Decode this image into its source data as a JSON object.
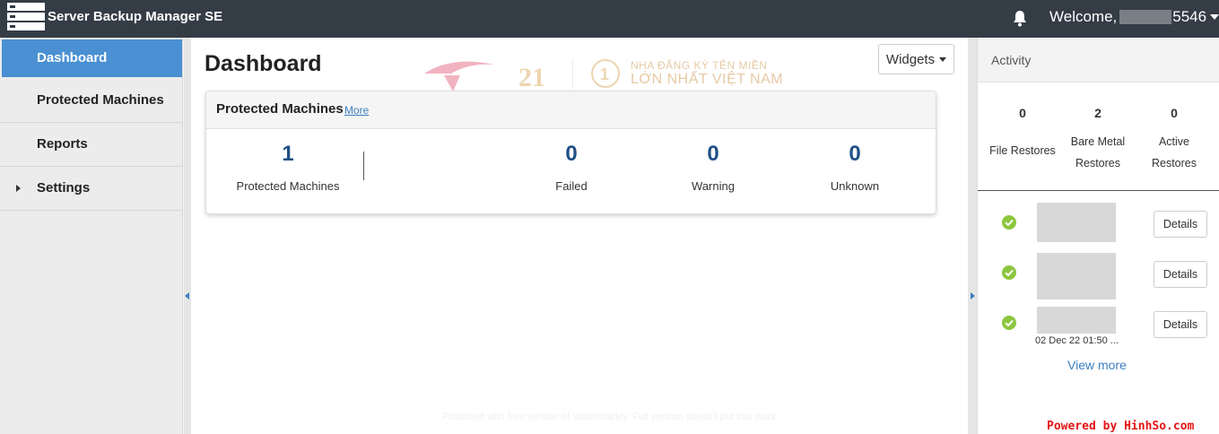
{
  "app": {
    "title": "Server Backup Manager SE"
  },
  "header": {
    "welcome_prefix": "Welcome,",
    "welcome_suffix": "5546"
  },
  "sidebar": {
    "items": [
      {
        "label": "Dashboard",
        "active": true
      },
      {
        "label": "Protected Machines"
      },
      {
        "label": "Reports"
      },
      {
        "label": "Settings",
        "expandable": true
      }
    ]
  },
  "main": {
    "title": "Dashboard",
    "widgets_label": "Widgets",
    "watermark": {
      "line1": "NHA ĐĂNG KÝ TÊN MIỀN",
      "line2": "LỚN NHẤT VIỆT NAM"
    },
    "card": {
      "title": "Protected Machines",
      "more_label": "More",
      "stats": [
        {
          "value": "1",
          "label": "Protected Machines"
        },
        {
          "value": "0",
          "label": "Failed"
        },
        {
          "value": "0",
          "label": "Warning"
        },
        {
          "value": "0",
          "label": "Unknown"
        }
      ]
    },
    "footer_watermark": "Protected with free version of Watermarkly. Full version doesn't put this mark."
  },
  "activity": {
    "title": "Activity",
    "stats": [
      {
        "value": "0",
        "label_line1": "File Restores",
        "label_line2": ""
      },
      {
        "value": "2",
        "label_line1": "Bare Metal",
        "label_line2": "Restores"
      },
      {
        "value": "0",
        "label_line1": "Active",
        "label_line2": "Restores"
      }
    ],
    "rows": [
      {
        "details_label": "Details"
      },
      {
        "details_label": "Details"
      },
      {
        "details_label": "Details"
      }
    ],
    "date_fragment": "02 Dec 22 01:50 ...",
    "view_more_label": "View more"
  },
  "footer": {
    "powered_by": "Powered by HinhSo.com"
  },
  "colors": {
    "topbar": "#343c46",
    "accent": "#4a90d2",
    "stat_blue": "#1f4f86",
    "success": "#8cc63f"
  }
}
